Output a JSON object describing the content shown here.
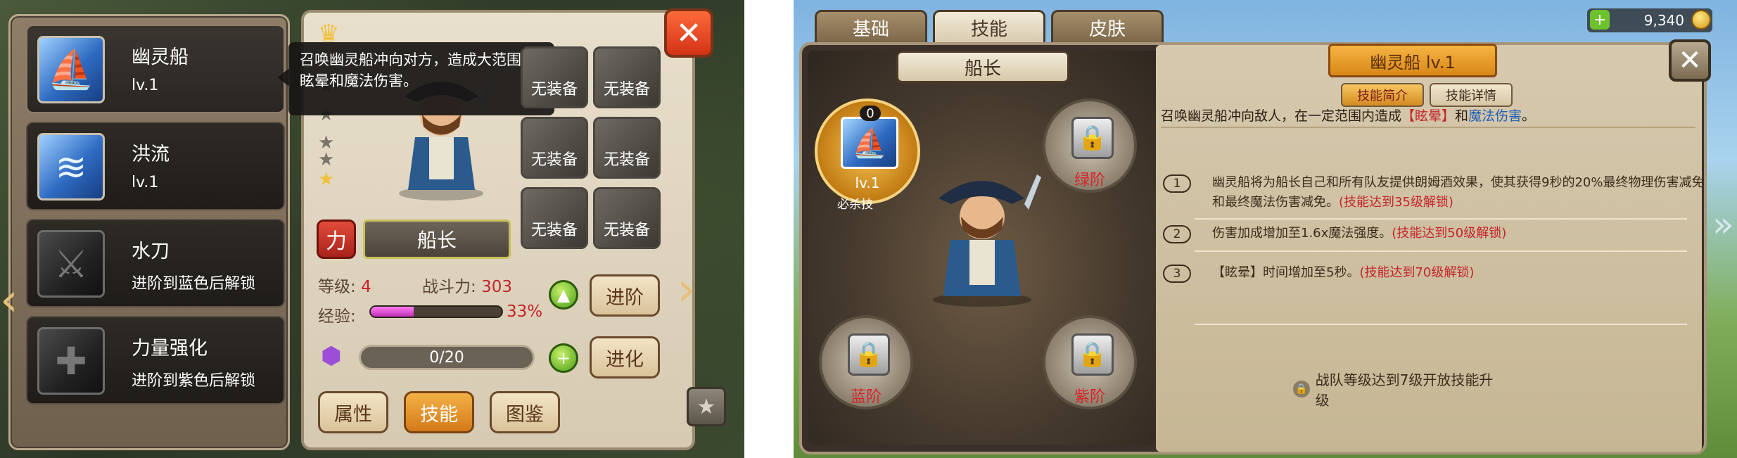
{
  "left_screen": {
    "skills": [
      {
        "name": "幽灵船",
        "sub": "lv.1",
        "icon": "ghost-ship-icon",
        "selected": true
      },
      {
        "name": "洪流",
        "sub": "lv.1",
        "icon": "torrent-icon",
        "selected": false
      },
      {
        "name": "水刀",
        "sub": "进阶到蓝色后解锁",
        "icon": "water-blade-icon",
        "selected": false
      },
      {
        "name": "力量强化",
        "sub": "进阶到紫色后解锁",
        "icon": "strength-boost-icon",
        "selected": false
      }
    ],
    "tooltip": "召唤幽灵船冲向对方，造成大范围的眩晕和魔法伤害。",
    "equip_slots": [
      "无装备",
      "无装备",
      "无装备",
      "无装备",
      "无装备",
      "无装备"
    ],
    "stars_filled": 1,
    "stars_total": 5,
    "attribute_badge": "力",
    "hero_name": "船长",
    "level_label": "等级:",
    "level_value": "4",
    "power_label": "战斗力:",
    "power_value": "303",
    "exp_label": "经验:",
    "exp_percent_text": "33%",
    "exp_progress": 0.33,
    "gem_progress": "0/20",
    "buttons": {
      "advance": "进阶",
      "evolve": "进化",
      "attributes": "属性",
      "skills": "技能",
      "codex": "图鉴"
    }
  },
  "right_screen": {
    "tabs": [
      "基础",
      "技能",
      "皮肤"
    ],
    "active_tab": "技能",
    "coins": "9,340",
    "hero_name": "船长",
    "active_skill": {
      "badge": "0",
      "level": "lv.1",
      "tag": "必杀技"
    },
    "locked_slots": [
      "绿阶",
      "蓝阶",
      "紫阶"
    ],
    "skill_title": "幽灵船  lv.1",
    "sub_tabs": [
      "技能简介",
      "技能详情"
    ],
    "description_prefix": "召唤幽灵船冲向敌人，在一定范围内造成",
    "description_stun": "【眩晕】",
    "description_mid": "和",
    "description_magic": "魔法伤害",
    "description_end": "。",
    "effects": [
      {
        "num": "1",
        "text": "幽灵船将为船长自己和所有队友提供朗姆酒效果，使其获得9秒的20%最终物理伤害减免和最终魔法伤害减免。",
        "unlock": "(技能达到35级解锁)"
      },
      {
        "num": "2",
        "text": "伤害加成增加至1.6x魔法强度。",
        "unlock": "(技能达到50级解锁)"
      },
      {
        "num": "3",
        "text": "【眩晕】时间增加至5秒。",
        "unlock": "(技能达到70级解锁)"
      }
    ],
    "lock_note": "战队等级达到7级开放技能升级"
  }
}
